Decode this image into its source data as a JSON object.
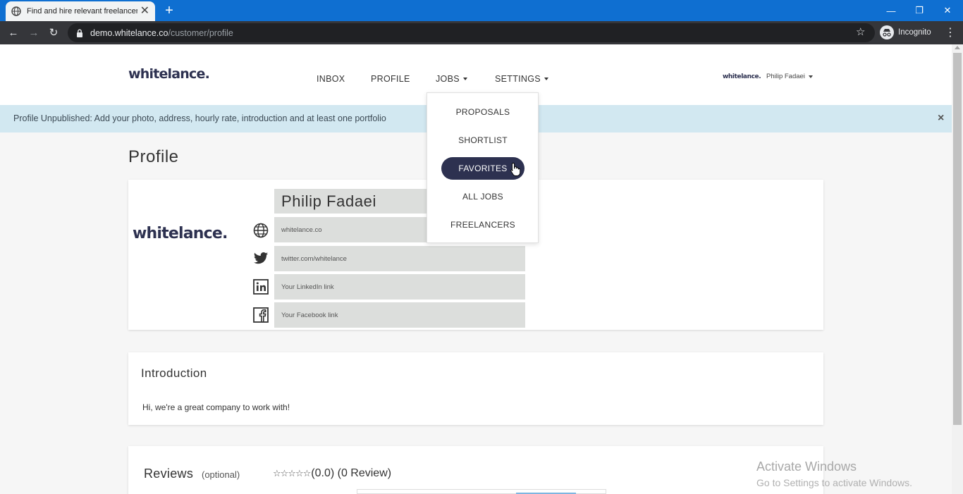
{
  "browser": {
    "tab_title": "Find and hire relevant freelancers",
    "tab_close": "✕",
    "new_tab": "+",
    "url_host": "demo.whitelance.co",
    "url_path": "/customer/profile",
    "incognito_label": "Incognito",
    "window_controls": {
      "minimize": "—",
      "maximize": "❐",
      "close": "✕"
    }
  },
  "header": {
    "logo": "whitelance.",
    "nav": {
      "inbox": "INBOX",
      "profile": "PROFILE",
      "jobs": "JOBS",
      "settings": "SETTINGS"
    },
    "user_logo": "whitelance.",
    "user_name": "Philip Fadaei"
  },
  "alert": {
    "text": "Profile Unpublished: Add your photo, address, hourly rate, introduction and at least one portfolio",
    "close": "×"
  },
  "jobs_dropdown": {
    "items": [
      {
        "label": "PROPOSALS",
        "active": false
      },
      {
        "label": "SHORTLIST",
        "active": false
      },
      {
        "label": "FAVORITES",
        "active": true
      },
      {
        "label": "ALL JOBS",
        "active": false
      },
      {
        "label": "FREELANCERS",
        "active": false
      }
    ]
  },
  "profile": {
    "page_title": "Profile",
    "company_logo": "whitelance.",
    "name": "Philip Fadaei",
    "website": "whitelance.co",
    "twitter": "twitter.com/whitelance",
    "linkedin_placeholder": "Your LinkedIn link",
    "facebook_placeholder": "Your Facebook link"
  },
  "introduction": {
    "title": "Introduction",
    "text": "Hi, we're a great company to work with!"
  },
  "reviews": {
    "title": "Reviews",
    "optional": "(optional)",
    "stars": "☆☆☆☆☆",
    "rating_text": "(0.0) (0 Review)"
  },
  "watermark": {
    "line1": "Activate Windows",
    "line2": "Go to Settings to activate Windows."
  }
}
